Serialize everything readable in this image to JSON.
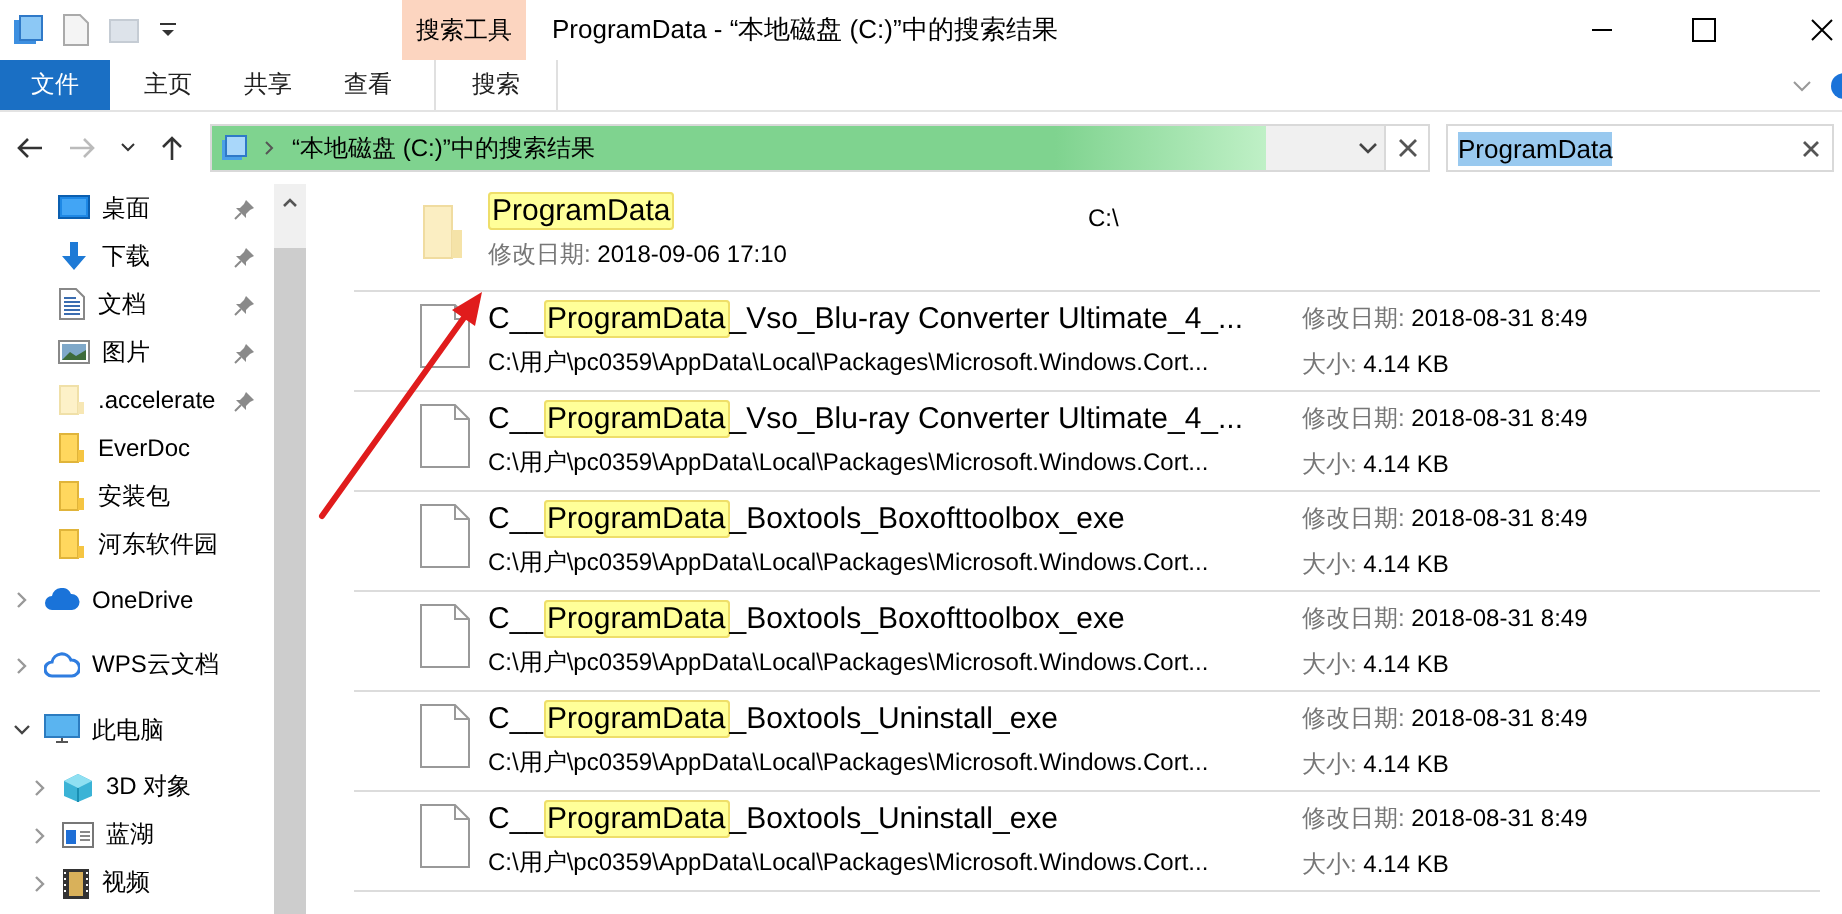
{
  "title_bar": {
    "contextual_group": "搜索工具",
    "title": "ProgramData - “本地磁盘 (C:)”中的搜索结果"
  },
  "ribbon": {
    "tabs": [
      {
        "label": "文件",
        "kind": "file",
        "selected": false
      },
      {
        "label": "主页",
        "kind": "normal",
        "selected": false
      },
      {
        "label": "共享",
        "kind": "normal",
        "selected": false
      },
      {
        "label": "查看",
        "kind": "normal",
        "selected": false
      },
      {
        "label": "搜索",
        "kind": "contextual",
        "selected": false
      }
    ]
  },
  "address_bar": {
    "path": "“本地磁盘 (C:)”中的搜索结果",
    "level": 0.9
  },
  "search": {
    "value": "ProgramData"
  },
  "navigation": {
    "items": [
      {
        "label": "桌面",
        "kind": "desktop",
        "pinned": true
      },
      {
        "label": "下载",
        "kind": "download",
        "pinned": true
      },
      {
        "label": "文档",
        "kind": "document",
        "pinned": true
      },
      {
        "label": "图片",
        "kind": "picture",
        "pinned": true
      },
      {
        "label": ".accelerate",
        "kind": "hidden",
        "pinned": true
      },
      {
        "label": "EverDoc",
        "kind": "folder",
        "pinned": false
      },
      {
        "label": "安装包",
        "kind": "folder",
        "pinned": false
      },
      {
        "label": "河东软件园",
        "kind": "folder",
        "pinned": false
      }
    ],
    "tree": [
      {
        "label": "OneDrive",
        "kind": "cloud",
        "expanded": false
      },
      {
        "label": "WPS云文档",
        "kind": "webcloud",
        "expanded": false
      },
      {
        "label": "此电脑",
        "kind": "computer",
        "expanded": true,
        "children": [
          {
            "label": "3D 对象",
            "kind": "objects",
            "expanded": false
          },
          {
            "label": "蓝湖",
            "kind": "app",
            "expanded": false
          },
          {
            "label": "视频",
            "kind": "video",
            "expanded": false
          }
        ]
      }
    ]
  },
  "results": [
    {
      "kind": "folder",
      "match": "ProgramData",
      "date_label": "修改日期:",
      "date": "2018-09-06 17:10",
      "location": "C:\\"
    },
    {
      "kind": "file",
      "name_before": "C__",
      "match": "ProgramData",
      "name_after": "_Vso_Blu-ray Converter Ultimate_4_...",
      "path": "C:\\用户\\pc0359\\AppData\\Local\\Packages\\Microsoft.Windows.Cort...",
      "date_label": "修改日期:",
      "date": "2018-08-31 8:49",
      "size_label": "大小:",
      "size": "4.14 KB"
    },
    {
      "kind": "file",
      "name_before": "C__",
      "match": "ProgramData",
      "name_after": "_Vso_Blu-ray Converter Ultimate_4_...",
      "path": "C:\\用户\\pc0359\\AppData\\Local\\Packages\\Microsoft.Windows.Cort...",
      "date_label": "修改日期:",
      "date": "2018-08-31 8:49",
      "size_label": "大小:",
      "size": "4.14 KB"
    },
    {
      "kind": "file",
      "name_before": "C__",
      "match": "ProgramData",
      "name_after": "_Boxtools_Boxofttoolbox_exe",
      "path": "C:\\用户\\pc0359\\AppData\\Local\\Packages\\Microsoft.Windows.Cort...",
      "date_label": "修改日期:",
      "date": "2018-08-31 8:49",
      "size_label": "大小:",
      "size": "4.14 KB"
    },
    {
      "kind": "file",
      "name_before": "C__",
      "match": "ProgramData",
      "name_after": "_Boxtools_Boxofttoolbox_exe",
      "path": "C:\\用户\\pc0359\\AppData\\Local\\Packages\\Microsoft.Windows.Cort...",
      "date_label": "修改日期:",
      "date": "2018-08-31 8:49",
      "size_label": "大小:",
      "size": "4.14 KB"
    },
    {
      "kind": "file",
      "name_before": "C__",
      "match": "ProgramData",
      "name_after": "_Boxtools_Uninstall_exe",
      "path": "C:\\用户\\pc0359\\AppData\\Local\\Packages\\Microsoft.Windows.Cort...",
      "date_label": "修改日期:",
      "date": "2018-08-31 8:49",
      "size_label": "大小:",
      "size": "4.14 KB"
    },
    {
      "kind": "file",
      "name_before": "C__",
      "match": "ProgramData",
      "name_after": "_Boxtools_Uninstall_exe",
      "path": "C:\\用户\\pc0359\\AppData\\Local\\Packages\\Microsoft.Windows.Cort...",
      "date_label": "修改日期:",
      "date": "2018-08-31 8:49",
      "size_label": "大小:",
      "size": "4.14 KB"
    }
  ],
  "annotations": [
    {
      "kind": "arrow",
      "color": "#e01c1c"
    }
  ]
}
